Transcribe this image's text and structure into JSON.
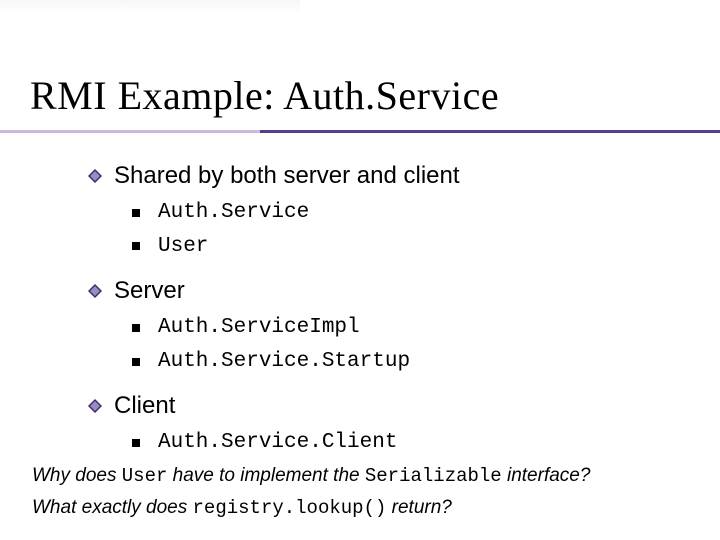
{
  "title": "RMI Example: Auth.Service",
  "colors": {
    "underline_light": "#c9b8e0",
    "underline_dark": "#5b3c88",
    "diamond_dark": "#3b2a66",
    "diamond_light": "#9a8cc2"
  },
  "bullets": {
    "shared": {
      "label": "Shared by both server and client",
      "items": [
        "Auth.Service",
        "User"
      ]
    },
    "server": {
      "label": "Server",
      "items": [
        "Auth.ServiceImpl",
        "Auth.Service.Startup"
      ]
    },
    "client": {
      "label": "Client",
      "items": [
        "Auth.Service.Client"
      ]
    }
  },
  "questions": {
    "q1_pre": "Why does ",
    "q1_code": "User",
    "q1_mid": " have to implement the ",
    "q1_code2": "Serializable",
    "q1_post": " interface?",
    "q2_pre": "What exactly does ",
    "q2_code": "registry.lookup()",
    "q2_post": " return?"
  }
}
